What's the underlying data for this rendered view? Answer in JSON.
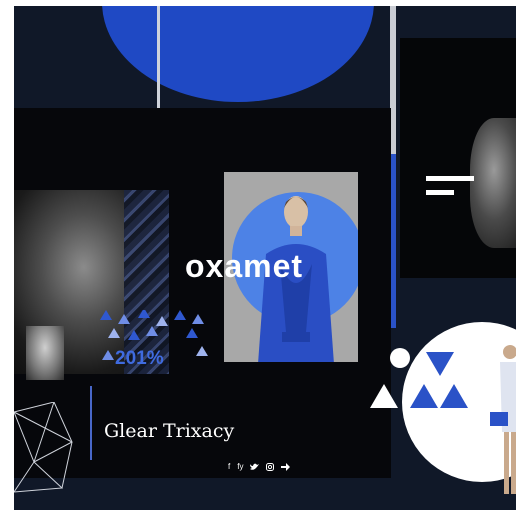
{
  "slide": {
    "wordmark": "oxamet",
    "subtitle": "Glear Trixacy",
    "percent": "201%"
  },
  "social": [
    "f",
    "fy",
    "tw-icon",
    "ig-icon",
    "arrow-icon"
  ],
  "social_labels": [
    "f",
    "fy"
  ],
  "colors": {
    "background": "#101828",
    "accent_blue": "#1f49c4",
    "light_blue": "#4d82e6",
    "white": "#ffffff"
  }
}
